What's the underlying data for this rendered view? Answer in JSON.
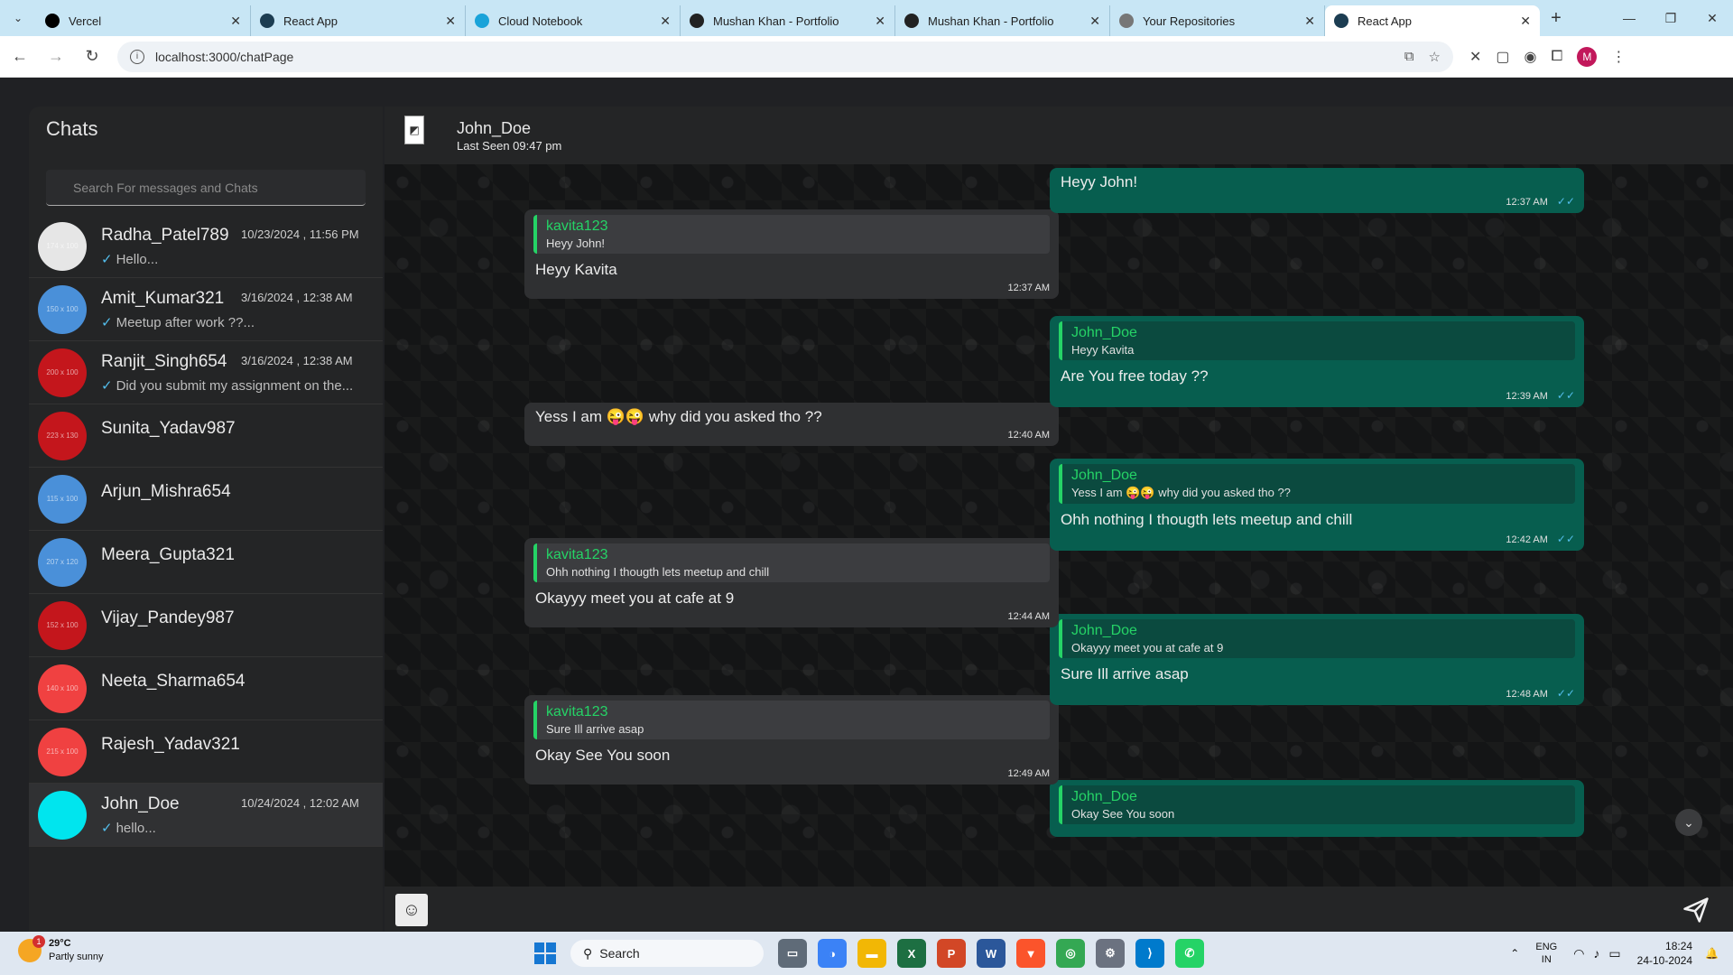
{
  "browser": {
    "tabs": [
      {
        "label": "Vercel",
        "icon": "vercel-icon",
        "color": "#000000",
        "active": false
      },
      {
        "label": "React App",
        "icon": "react-icon",
        "color": "#1c3d52",
        "active": false
      },
      {
        "label": "Cloud Notebook",
        "icon": "cloud-icon",
        "color": "#1aa3d9",
        "active": false
      },
      {
        "label": "Mushan Khan - Portfolio",
        "icon": "portfolio-icon",
        "color": "#222222",
        "active": false
      },
      {
        "label": "Mushan Khan - Portfolio",
        "icon": "portfolio-icon",
        "color": "#222222",
        "active": false
      },
      {
        "label": "Your Repositories",
        "icon": "github-icon",
        "color": "#777777",
        "active": false
      },
      {
        "label": "React App",
        "icon": "react-icon",
        "color": "#1c3d52",
        "active": true
      }
    ],
    "url": "localhost:3000/chatPage",
    "profile_initial": "M"
  },
  "sidebar": {
    "title": "Chats",
    "search_placeholder": "Search For messages and Chats",
    "chats": [
      {
        "name": "Radha_Patel789",
        "time": "10/23/2024 , 11:56 PM",
        "preview": "Hello...",
        "avatar_color": "#e6e6e6",
        "avatar_text": "174 x 100"
      },
      {
        "name": "Amit_Kumar321",
        "time": "3/16/2024 , 12:38 AM",
        "preview": "Meetup after work ??...",
        "avatar_color": "#4a90d9",
        "avatar_text": "150 x 100"
      },
      {
        "name": "Ranjit_Singh654",
        "time": "3/16/2024 , 12:38 AM",
        "preview": "Did you submit my assignment on the...",
        "avatar_color": "#c4161c",
        "avatar_text": "200 x 100"
      },
      {
        "name": "Sunita_Yadav987",
        "time": "",
        "preview": "",
        "avatar_color": "#c4161c",
        "avatar_text": "223 x 130"
      },
      {
        "name": "Arjun_Mishra654",
        "time": "",
        "preview": "",
        "avatar_color": "#4a90d9",
        "avatar_text": "115 x 100"
      },
      {
        "name": "Meera_Gupta321",
        "time": "",
        "preview": "",
        "avatar_color": "#4a90d9",
        "avatar_text": "207 x 120"
      },
      {
        "name": "Vijay_Pandey987",
        "time": "",
        "preview": "",
        "avatar_color": "#c4161c",
        "avatar_text": "152 x 100"
      },
      {
        "name": "Neeta_Sharma654",
        "time": "",
        "preview": "",
        "avatar_color": "#f04141",
        "avatar_text": "140 x 100"
      },
      {
        "name": "Rajesh_Yadav321",
        "time": "",
        "preview": "",
        "avatar_color": "#f04141",
        "avatar_text": "215 x 100"
      },
      {
        "name": "John_Doe",
        "time": "10/24/2024 , 12:02 AM",
        "preview": "hello...",
        "avatar_color": "#00e5ee",
        "avatar_text": "",
        "active": true
      }
    ]
  },
  "chat": {
    "name": "John_Doe",
    "last_seen": "Last Seen 09:47 pm",
    "messages": [
      {
        "dir": "sent",
        "text": "Heyy John!",
        "time": "12:37 AM",
        "quote_name": "",
        "quote_text": ""
      },
      {
        "dir": "recv",
        "text": "Heyy Kavita",
        "time": "12:37 AM",
        "quote_name": "kavita123",
        "quote_text": "Heyy John!"
      },
      {
        "dir": "sent",
        "text": "Are You free today ??",
        "time": "12:39 AM",
        "quote_name": "John_Doe",
        "quote_text": "Heyy Kavita"
      },
      {
        "dir": "recv",
        "text": "Yess I am 😜😜 why did you asked tho ??",
        "time": "12:40 AM",
        "quote_name": "",
        "quote_text": ""
      },
      {
        "dir": "sent",
        "text": "Ohh nothing I thougth lets meetup and chill",
        "time": "12:42 AM",
        "quote_name": "John_Doe",
        "quote_text": "Yess I am 😜😜 why did you asked tho ??"
      },
      {
        "dir": "recv",
        "text": "Okayyy meet you at cafe at 9",
        "time": "12:44 AM",
        "quote_name": "kavita123",
        "quote_text": "Ohh nothing I thougth lets meetup and chill"
      },
      {
        "dir": "sent",
        "text": "Sure Ill arrive asap",
        "time": "12:48 AM",
        "quote_name": "John_Doe",
        "quote_text": "Okayyy meet you at cafe at 9"
      },
      {
        "dir": "recv",
        "text": "Okay See You soon",
        "time": "12:49 AM",
        "quote_name": "kavita123",
        "quote_text": "Sure Ill arrive asap"
      },
      {
        "dir": "sent",
        "text": "",
        "time": "",
        "quote_name": "John_Doe",
        "quote_text": "Okay See You soon"
      }
    ]
  },
  "taskbar": {
    "temp": "29°C",
    "weather": "Partly sunny",
    "weather_badge": "1",
    "search": "Search",
    "lang_top": "ENG",
    "lang_bottom": "IN",
    "time": "18:24",
    "date": "24-10-2024"
  }
}
